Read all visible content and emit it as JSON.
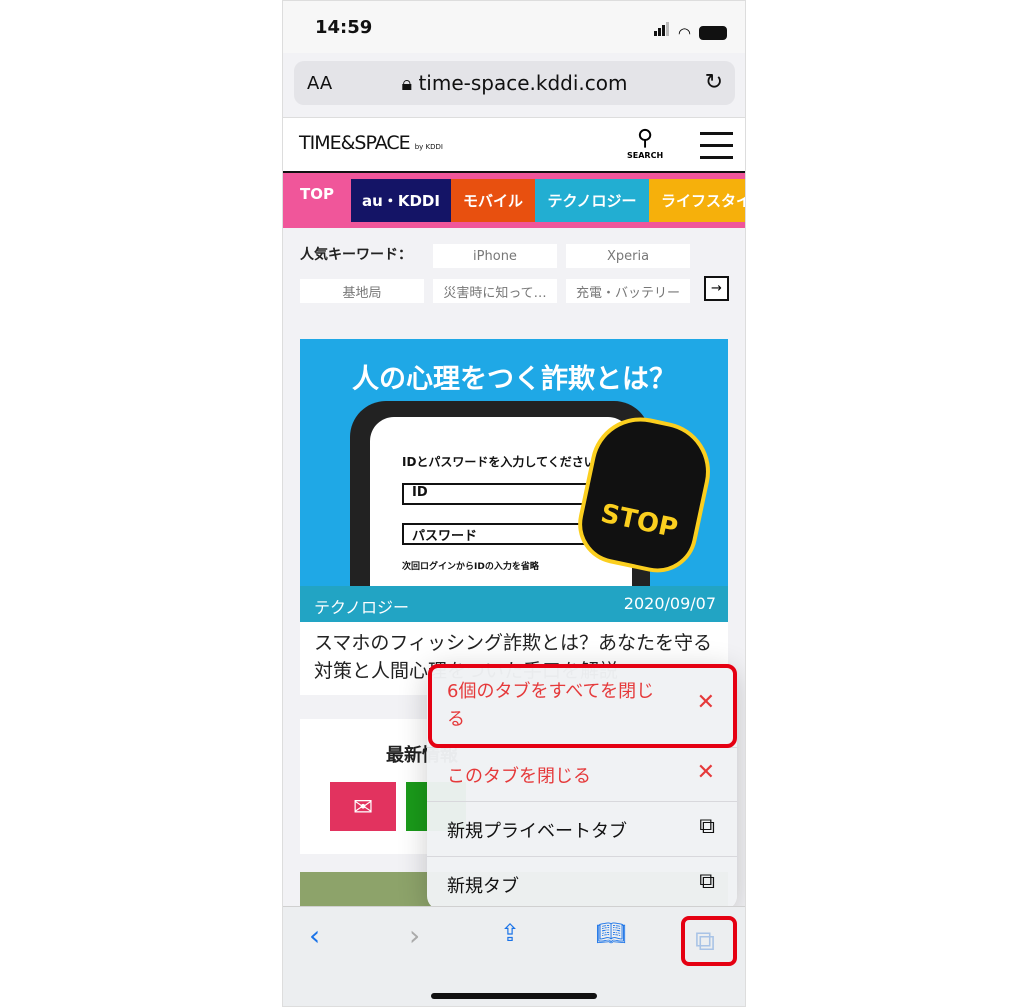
{
  "status": {
    "time": "14:59"
  },
  "browser": {
    "text_size": "AA",
    "url": "time-space.kddi.com"
  },
  "site": {
    "logo": "TIME&SPACE",
    "logo_sub": "by KDDI",
    "search_label": "SEARCH",
    "categories": [
      {
        "label": "TOP",
        "color": "#f0569a"
      },
      {
        "label": "au・KDDI",
        "color": "#141466"
      },
      {
        "label": "モバイル",
        "color": "#e8500f"
      },
      {
        "label": "テクノロジー",
        "color": "#22aed2"
      },
      {
        "label": "ライフスタイ",
        "color": "#f6b00b"
      }
    ],
    "keyword_label": "人気キーワード：",
    "keywords": [
      "iPhone",
      "Xperia",
      "基地局",
      "災害時に知って…",
      "充電・バッテリー"
    ]
  },
  "article": {
    "hero_heading": "人の心理をつく詐欺とは？",
    "hero_prompt": "IDとパスワードを入力してください",
    "hero_id": "ID",
    "hero_password": "パスワード",
    "hero_checkbox": "次回ログインからIDの入力を省略",
    "hero_stop": "STOP",
    "category": "テクノロジー",
    "date": "2020/09/07",
    "title": "スマホのフィッシング詐欺とは？あなたを守る対策と人間心理をついた手口を解説"
  },
  "section2": {
    "heading": "最新情報"
  },
  "menu": {
    "items": [
      {
        "label": "6個のタブをすべてを閉じる",
        "icon": "close-icon"
      },
      {
        "label": "このタブを閉じる",
        "icon": "close-icon"
      },
      {
        "label": "新規プライベートタブ",
        "icon": "new-private-tab-icon"
      },
      {
        "label": "新規タブ",
        "icon": "new-tab-icon"
      }
    ]
  },
  "colors": {
    "highlight": "#e50012",
    "destructive": "#e5393a",
    "accent": "#1a73e8"
  }
}
